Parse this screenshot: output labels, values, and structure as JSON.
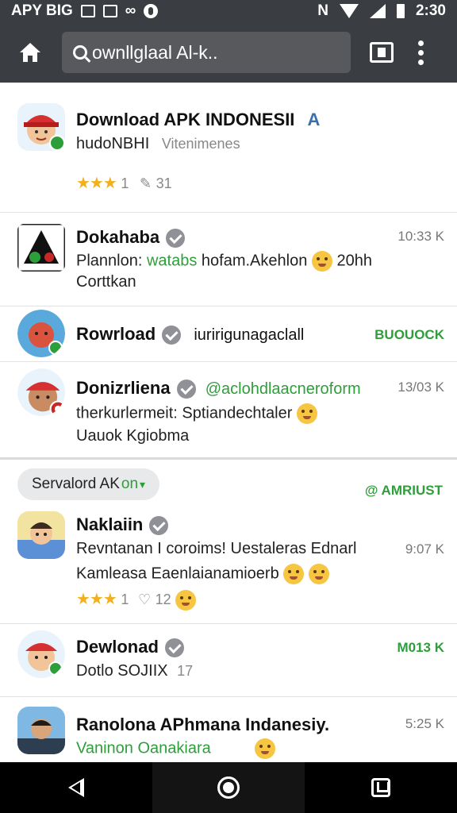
{
  "status_bar": {
    "left_text": "APY BIG",
    "time": "2:30",
    "network": "N"
  },
  "app_bar": {
    "search_text": "ownllglaal Al-k.."
  },
  "rows": [
    {
      "title": "Download APK INDONESII",
      "line1": "hudoNBHI",
      "line1_muted": "Vitenimenes",
      "rating_stars": "★★★",
      "rating_text": "1",
      "rating_count": "31",
      "tag": "A"
    },
    {
      "title": "Dokahaba",
      "line1_a": "Plannlon:",
      "line1_green": "watabs",
      "line1_b": "hofam.Akehlon",
      "line1_c": "20hh",
      "line2": "Corttkan",
      "time": "10:33 K"
    },
    {
      "title": "Rowrload",
      "line1": "iuririgunagaclall",
      "time": "BUOUOCK"
    },
    {
      "title": "Donizrliena",
      "title_green": "@aclohdlaacneroform",
      "line1": "therkurlermeit: Sptiandechtaler",
      "line2": "Uauok Kgiobma",
      "time": "13/03 K"
    },
    {
      "title": "Naklaiin",
      "line1": "Revntanan I coroims! Uestaleras Ednarl",
      "line2": "Kamleasa Eaenlaianamioerb",
      "rating_stars": "★★★",
      "rating_text": "1",
      "rating_count": "12",
      "time": "9:07 K"
    },
    {
      "title": "Dewlonad",
      "line1": "Dotlo SOJIIX",
      "line1_num": "17",
      "time": "M013 K"
    },
    {
      "title": "Ranolona APhmana Indanesiy.",
      "line1": "Vaninon Oanakiara",
      "time": "5:25 K"
    }
  ],
  "section": {
    "chip_label": "Servalord AK",
    "chip_green": "on",
    "chip_arrow": "▾",
    "action": "@ AMRIUST"
  },
  "colors": {
    "bar": "#3a3d41",
    "green": "#2e9e3a",
    "star": "#f2b01e",
    "verified": "#8f9196"
  },
  "icons": {
    "home": "home-icon",
    "search": "search-icon",
    "tabs": "tabs-icon",
    "menu": "more-vert-icon",
    "back": "back-icon",
    "nav_home": "nav-home-icon",
    "recents": "recents-icon"
  }
}
